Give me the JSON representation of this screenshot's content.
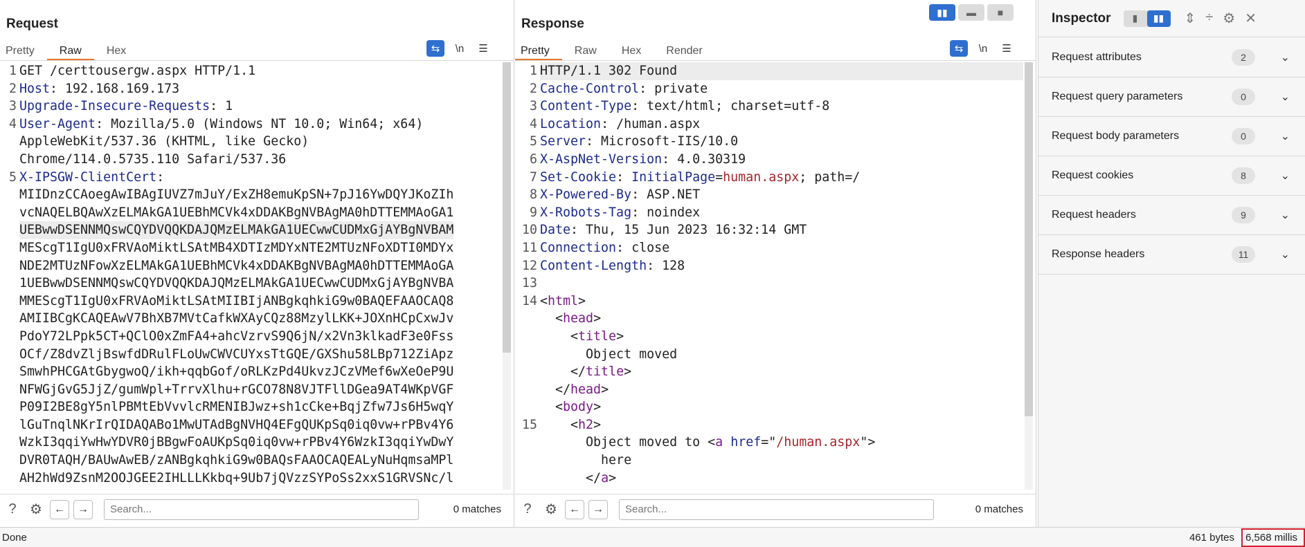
{
  "request": {
    "title": "Request",
    "tabs": [
      "Pretty",
      "Raw",
      "Hex"
    ],
    "active_tab": "Raw",
    "tools": {
      "wrap_icon": "wrap-icon",
      "newline_label": "\\n",
      "menu_icon": "hamburger-icon"
    },
    "lines": [
      {
        "n": "1",
        "name": "",
        "value": "GET /certtousergw.aspx HTTP/1.1"
      },
      {
        "n": "2",
        "name": "Host",
        "value": ": 192.168.169.173"
      },
      {
        "n": "3",
        "name": "Upgrade-Insecure-Requests",
        "value": ": 1"
      },
      {
        "n": "4",
        "name": "User-Agent",
        "value": ": Mozilla/5.0 (Windows NT 10.0; Win64; x64)"
      },
      {
        "n": "",
        "name": "",
        "value": "AppleWebKit/537.36 (KHTML, like Gecko)"
      },
      {
        "n": "",
        "name": "",
        "value": "Chrome/114.0.5735.110 Safari/537.36"
      },
      {
        "n": "5",
        "name": "X-IPSGW-ClientCert",
        "value": ":"
      },
      {
        "n": "",
        "name": "",
        "value": "MIIDnzCCAoegAwIBAgIUVZ7mJuY/ExZH8emuKpSN+7pJ16YwDQYJKoZIh"
      },
      {
        "n": "",
        "name": "",
        "value": "vcNAQELBQAwXzELMAkGA1UEBhMCVk4xDDAKBgNVBAgMA0hDTTEMMAoGA1"
      },
      {
        "n": "",
        "name": "",
        "value": "UEBwwDSENNMQswCQYDVQQKDAJQMzELMAkGA1UECwwCUDMxGjAYBgNVBAM",
        "hl": true
      },
      {
        "n": "",
        "name": "",
        "value": "MEScgT1IgU0xFRVAoMiktLSAtMB4XDTIzMDYxNTE2MTUzNFoXDTI0MDYx"
      },
      {
        "n": "",
        "name": "",
        "value": "NDE2MTUzNFowXzELMAkGA1UEBhMCVk4xDDAKBgNVBAgMA0hDTTEMMAoGA"
      },
      {
        "n": "",
        "name": "",
        "value": "1UEBwwDSENNMQswCQYDVQQKDAJQMzELMAkGA1UECwwCUDMxGjAYBgNVBA"
      },
      {
        "n": "",
        "name": "",
        "value": "MMEScgT1IgU0xFRVAoMiktLSAtMIIBIjANBgkqhkiG9w0BAQEFAAOCAQ8"
      },
      {
        "n": "",
        "name": "",
        "value": "AMIIBCgKCAQEAwV7BhXB7MVtCafkWXAyCQz88MzylLKK+JOXnHCpCxwJv"
      },
      {
        "n": "",
        "name": "",
        "value": "PdoY72LPpk5CT+QClO0xZmFA4+ahcVzrvS9Q6jN/x2Vn3klkadF3e0Fss"
      },
      {
        "n": "",
        "name": "",
        "value": "OCf/Z8dvZljBswfdDRulFLoUwCWVCUYxsTtGQE/GXShu58LBp712ZiApz"
      },
      {
        "n": "",
        "name": "",
        "value": "SmwhPHCGAtGbygwoQ/ikh+qqbGof/oRLKzPd4UkvzJCzVMef6wXeOeP9U"
      },
      {
        "n": "",
        "name": "",
        "value": "NFWGjGvG5JjZ/gumWpl+TrrvXlhu+rGCO78N8VJTFllDGea9AT4WKpVGF"
      },
      {
        "n": "",
        "name": "",
        "value": "P09I2BE8gY5nlPBMtEbVvvlcRMENIBJwz+sh1cCke+BqjZfw7Js6H5wqY"
      },
      {
        "n": "",
        "name": "",
        "value": "lGuTnqlNKrIrQIDAQABo1MwUTAdBgNVHQ4EFgQUKpSq0iq0vw+rPBv4Y6"
      },
      {
        "n": "",
        "name": "",
        "value": "WzkI3qqiYwHwYDVR0jBBgwFoAUKpSq0iq0vw+rPBv4Y6WzkI3qqiYwDwY"
      },
      {
        "n": "",
        "name": "",
        "value": "DVR0TAQH/BAUwAwEB/zANBgkqhkiG9w0BAQsFAAOCAQEALyNuHqmsaMPl"
      },
      {
        "n": "",
        "name": "",
        "value": "AH2hWd9ZsnM2OOJGEE2IHLLLKkbq+9Ub7jQVzzSYPoSs2xxS1GRVSNc/l"
      }
    ],
    "search_placeholder": "Search...",
    "matches": "0 matches"
  },
  "response": {
    "title": "Response",
    "tabs": [
      "Pretty",
      "Raw",
      "Hex",
      "Render"
    ],
    "active_tab": "Pretty",
    "lines": [
      {
        "n": "1",
        "parts": [
          {
            "t": "HTTP/1.1 302 Found",
            "c": "code"
          }
        ],
        "hl": true
      },
      {
        "n": "2",
        "parts": [
          {
            "t": "Cache-Control",
            "c": "hname"
          },
          {
            "t": ": private",
            "c": "code"
          }
        ]
      },
      {
        "n": "3",
        "parts": [
          {
            "t": "Content-Type",
            "c": "hname"
          },
          {
            "t": ": text/html; charset=utf-8",
            "c": "code"
          }
        ]
      },
      {
        "n": "4",
        "parts": [
          {
            "t": "Location",
            "c": "hname"
          },
          {
            "t": ": /human.aspx",
            "c": "code"
          }
        ]
      },
      {
        "n": "5",
        "parts": [
          {
            "t": "Server",
            "c": "hname"
          },
          {
            "t": ": Microsoft-IIS/10.0",
            "c": "code"
          }
        ]
      },
      {
        "n": "6",
        "parts": [
          {
            "t": "X-AspNet-Version",
            "c": "hname"
          },
          {
            "t": ": 4.0.30319",
            "c": "code"
          }
        ]
      },
      {
        "n": "7",
        "parts": [
          {
            "t": "Set-Cookie",
            "c": "hname"
          },
          {
            "t": ": ",
            "c": "code"
          },
          {
            "t": "InitialPage",
            "c": "attr"
          },
          {
            "t": "=",
            "c": "code"
          },
          {
            "t": "human.aspx",
            "c": "sval"
          },
          {
            "t": "; path=/",
            "c": "code"
          }
        ]
      },
      {
        "n": "8",
        "parts": [
          {
            "t": "X-Powered-By",
            "c": "hname"
          },
          {
            "t": ": ASP.NET",
            "c": "code"
          }
        ]
      },
      {
        "n": "9",
        "parts": [
          {
            "t": "X-Robots-Tag",
            "c": "hname"
          },
          {
            "t": ": noindex",
            "c": "code"
          }
        ]
      },
      {
        "n": "10",
        "parts": [
          {
            "t": "Date",
            "c": "hname"
          },
          {
            "t": ": Thu, 15 Jun 2023 16:32:14 GMT",
            "c": "code"
          }
        ]
      },
      {
        "n": "11",
        "parts": [
          {
            "t": "Connection",
            "c": "hname"
          },
          {
            "t": ": close",
            "c": "code"
          }
        ]
      },
      {
        "n": "12",
        "parts": [
          {
            "t": "Content-Length",
            "c": "hname"
          },
          {
            "t": ": 128",
            "c": "code"
          }
        ]
      },
      {
        "n": "13",
        "parts": []
      },
      {
        "n": "14",
        "parts": [
          {
            "t": "<",
            "c": "code"
          },
          {
            "t": "html",
            "c": "tag"
          },
          {
            "t": ">",
            "c": "code"
          }
        ]
      },
      {
        "n": "",
        "parts": [
          {
            "t": "  <",
            "c": "code"
          },
          {
            "t": "head",
            "c": "tag"
          },
          {
            "t": ">",
            "c": "code"
          }
        ]
      },
      {
        "n": "",
        "parts": [
          {
            "t": "    <",
            "c": "code"
          },
          {
            "t": "title",
            "c": "tag"
          },
          {
            "t": ">",
            "c": "code"
          }
        ]
      },
      {
        "n": "",
        "parts": [
          {
            "t": "      Object moved",
            "c": "code"
          }
        ]
      },
      {
        "n": "",
        "parts": [
          {
            "t": "    </",
            "c": "code"
          },
          {
            "t": "title",
            "c": "tag"
          },
          {
            "t": ">",
            "c": "code"
          }
        ]
      },
      {
        "n": "",
        "parts": [
          {
            "t": "  </",
            "c": "code"
          },
          {
            "t": "head",
            "c": "tag"
          },
          {
            "t": ">",
            "c": "code"
          }
        ]
      },
      {
        "n": "",
        "parts": [
          {
            "t": "  <",
            "c": "code"
          },
          {
            "t": "body",
            "c": "tag"
          },
          {
            "t": ">",
            "c": "code"
          }
        ]
      },
      {
        "n": "15",
        "parts": [
          {
            "t": "    <",
            "c": "code"
          },
          {
            "t": "h2",
            "c": "tag"
          },
          {
            "t": ">",
            "c": "code"
          }
        ]
      },
      {
        "n": "",
        "parts": [
          {
            "t": "      Object moved to <",
            "c": "code"
          },
          {
            "t": "a",
            "c": "tag"
          },
          {
            "t": " ",
            "c": "code"
          },
          {
            "t": "href",
            "c": "attr"
          },
          {
            "t": "=\"",
            "c": "code"
          },
          {
            "t": "/human.aspx",
            "c": "sval"
          },
          {
            "t": "\">",
            "c": "code"
          }
        ]
      },
      {
        "n": "",
        "parts": [
          {
            "t": "        here",
            "c": "code"
          }
        ]
      },
      {
        "n": "",
        "parts": [
          {
            "t": "      </",
            "c": "code"
          },
          {
            "t": "a",
            "c": "tag"
          },
          {
            "t": ">",
            "c": "code"
          }
        ]
      }
    ],
    "search_placeholder": "Search...",
    "matches": "0 matches"
  },
  "layout_switch": [
    "split-columns-icon",
    "split-rows-icon",
    "single-pane-icon"
  ],
  "inspector": {
    "title": "Inspector",
    "rows": [
      {
        "label": "Request attributes",
        "count": "2"
      },
      {
        "label": "Request query parameters",
        "count": "0"
      },
      {
        "label": "Request body parameters",
        "count": "0"
      },
      {
        "label": "Request cookies",
        "count": "8"
      },
      {
        "label": "Request headers",
        "count": "9"
      },
      {
        "label": "Response headers",
        "count": "11"
      }
    ]
  },
  "status": {
    "left": "Done",
    "bytes": "461 bytes",
    "millis": "6,568 millis"
  },
  "colors": {
    "accent": "#2e6fd0",
    "tab_underline": "#e8762c",
    "highlight_border": "#d31f2a"
  }
}
